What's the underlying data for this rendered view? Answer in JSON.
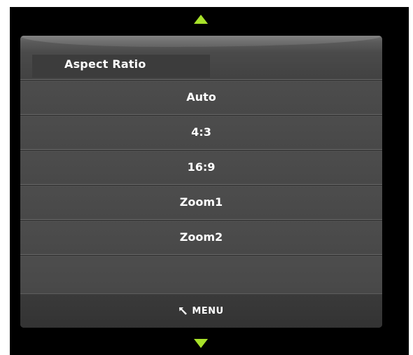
{
  "header": {
    "title": "Aspect Ratio"
  },
  "menu": {
    "items": [
      {
        "label": "Auto"
      },
      {
        "label": "4:3"
      },
      {
        "label": "16:9"
      },
      {
        "label": "Zoom1"
      },
      {
        "label": "Zoom2"
      }
    ]
  },
  "footer": {
    "back_label": "MENU",
    "icon": "back-arrow-icon"
  },
  "nav": {
    "up_icon": "up-arrow-icon",
    "down_icon": "down-arrow-icon"
  },
  "colors": {
    "accent": "#a8e22a",
    "background": "#000000",
    "panel": "#4a4a4a"
  }
}
